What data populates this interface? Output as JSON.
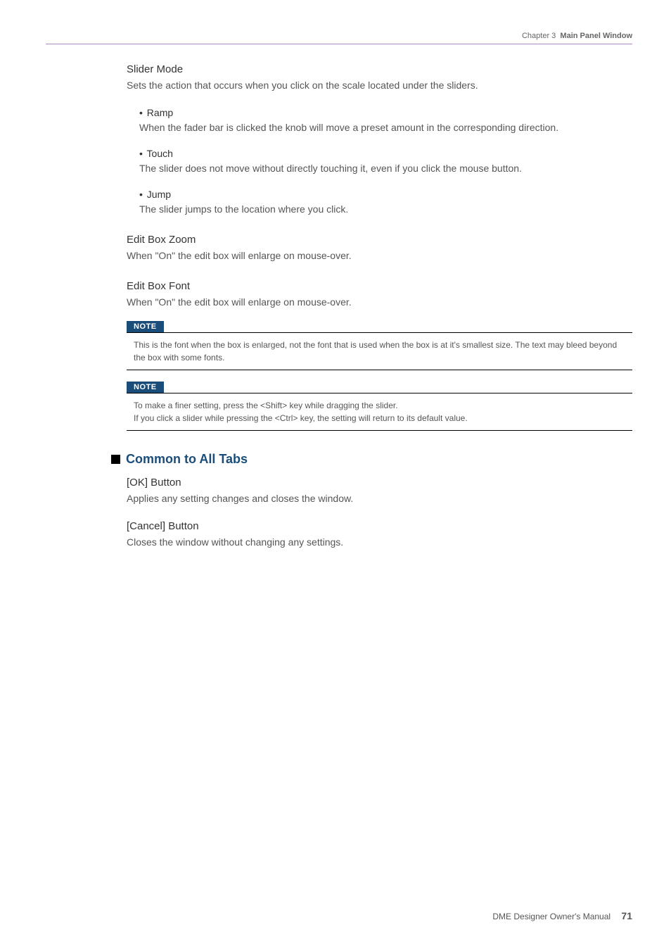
{
  "header": {
    "chapter": "Chapter 3",
    "title": "Main Panel Window"
  },
  "sections": {
    "sliderMode": {
      "heading": "Slider Mode",
      "desc": "Sets the action that occurs when you click on the scale located under the sliders.",
      "items": {
        "ramp": {
          "label": "Ramp",
          "desc": "When the fader bar is clicked the knob will move a preset amount in the corresponding direction."
        },
        "touch": {
          "label": "Touch",
          "desc": "The slider does not move without directly touching it, even if you click the mouse button."
        },
        "jump": {
          "label": "Jump",
          "desc": "The slider jumps to the location where you click."
        }
      }
    },
    "editBoxZoom": {
      "heading": "Edit Box Zoom",
      "desc": "When \"On\" the edit box will enlarge on mouse-over."
    },
    "editBoxFont": {
      "heading": "Edit Box Font",
      "desc": "When \"On\" the edit box will enlarge on mouse-over."
    }
  },
  "notes": {
    "label": "NOTE",
    "note1": "This is the font when the box is enlarged, not the font that is used when the box is at it's smallest size. The text may bleed beyond the box with some fonts.",
    "note2a": "To make a finer setting, press the <Shift> key while dragging the slider.",
    "note2b": "If you click a slider while pressing the <Ctrl> key, the setting will return to its default value."
  },
  "commonTabs": {
    "heading": "Common to All Tabs",
    "okButton": {
      "heading": "[OK] Button",
      "desc": "Applies any setting changes and closes the window."
    },
    "cancelButton": {
      "heading": "[Cancel] Button",
      "desc": "Closes the window without changing any settings."
    }
  },
  "footer": {
    "text": "DME Designer Owner's Manual",
    "pageNum": "71"
  }
}
